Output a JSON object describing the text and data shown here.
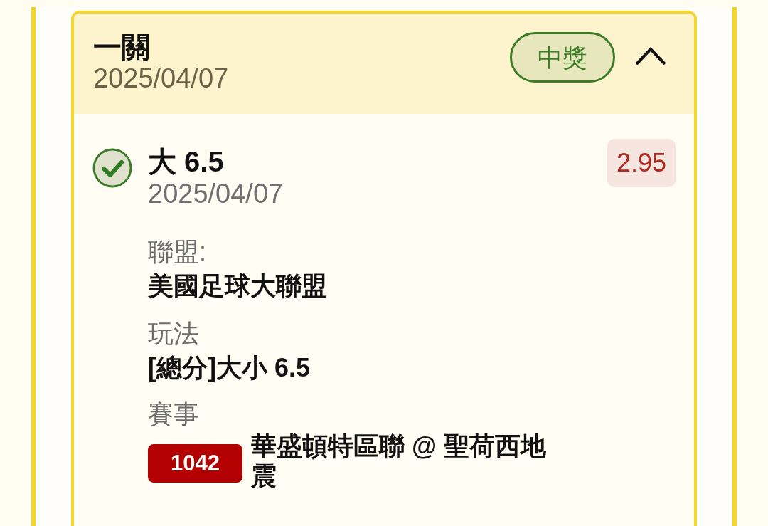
{
  "ticket": {
    "title": "一關",
    "date": "2025/04/07",
    "badge": "中獎",
    "expanded": true
  },
  "legs": [
    {
      "won": true,
      "pick": "大 6.5",
      "date": "2025/04/07",
      "odds": "2.95",
      "fields": [
        {
          "label": "聯盟:",
          "value": "美國足球大聯盟"
        },
        {
          "label": "玩法",
          "value": "[總分]大小 6.5"
        }
      ],
      "event": {
        "label": "賽事",
        "number": "1042",
        "name": "華盛頓特區聯 @ 聖荷西地震"
      }
    }
  ]
}
